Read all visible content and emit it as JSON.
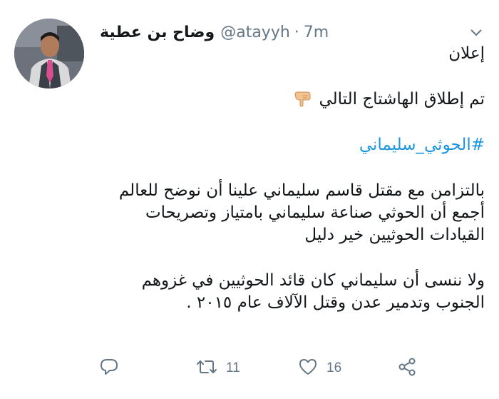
{
  "tweet": {
    "display_name": "وضاح بن عطية",
    "handle": "@atayyh",
    "separator": "·",
    "time": "7m",
    "lines": {
      "announce": "إعلان",
      "launched": "تم إطلاق الهاشتاج التالي",
      "hashtag": "#الحوثي_سليماني",
      "p1_l1": "بالتزامن مع مقتل قاسم سليماني علينا أن نوضح للعالم",
      "p1_l2": "أجمع أن الحوثي صناعة سليماني بامتياز وتصريحات",
      "p1_l3": "القيادات الحوثيين خير دليل",
      "p2_l1": "ولا ننسى أن سليماني كان قائد الحوثيين في غزوهم",
      "p2_l2": "الجنوب وتدمير عدن وقتل الآلاف عام ٢٠١٥ ."
    },
    "pointing_emoji_icon": "backhand-index-pointing-down-icon",
    "actions": {
      "reply_icon": "reply-icon",
      "retweet_icon": "retweet-icon",
      "retweet_count": "11",
      "like_icon": "heart-icon",
      "like_count": "16",
      "share_icon": "share-icon"
    },
    "colors": {
      "text": "#14171a",
      "secondary": "#657786",
      "link": "#1b95e0"
    }
  }
}
